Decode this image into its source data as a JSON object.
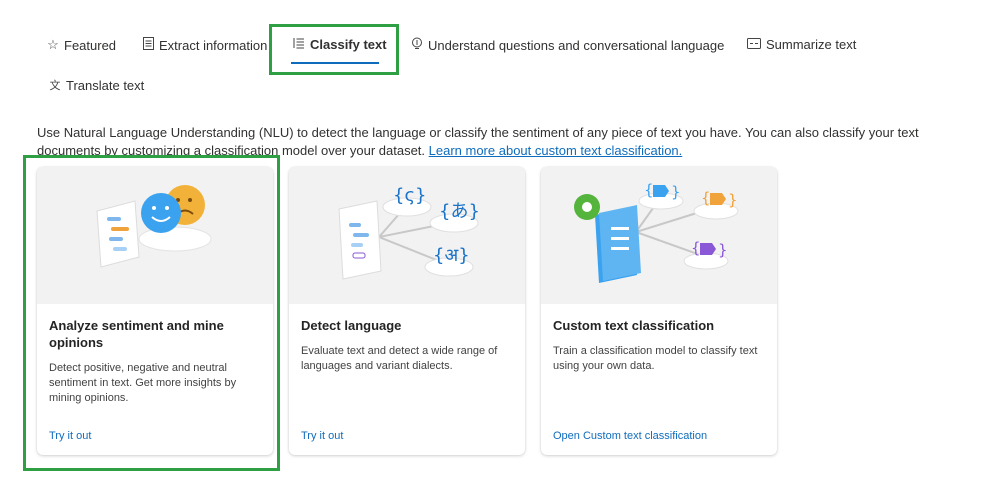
{
  "tabs": [
    {
      "label": "Featured",
      "icon": "star-icon"
    },
    {
      "label": "Extract information",
      "icon": "document-icon"
    },
    {
      "label": "Classify text",
      "icon": "list-icon"
    },
    {
      "label": "Understand questions and conversational language",
      "icon": "chat-bulb-icon"
    },
    {
      "label": "Summarize text",
      "icon": "summary-icon"
    },
    {
      "label": "Translate text",
      "icon": "translate-icon"
    }
  ],
  "active_tab": "Classify text",
  "description": {
    "text": "Use Natural Language Understanding (NLU) to detect the language or classify the sentiment of any piece of text you have. You can also classify your text documents by customizing a classification model over your dataset. ",
    "link": "Learn more about custom text classification."
  },
  "cards": [
    {
      "title": "Analyze sentiment and mine opinions",
      "body": "Detect positive, negative and neutral sentiment in text. Get more insights by mining opinions.",
      "link": "Try it out"
    },
    {
      "title": "Detect language",
      "body": "Evaluate text and detect a wide range of languages and variant dialects.",
      "link": "Try it out"
    },
    {
      "title": "Custom text classification",
      "body": "Train a classification model to classify text using your own data.",
      "link": "Open Custom text classification"
    }
  ],
  "colors": {
    "accent": "#0f6cbd",
    "highlight": "#2ea043",
    "art_bg": "#f2f2f2"
  }
}
